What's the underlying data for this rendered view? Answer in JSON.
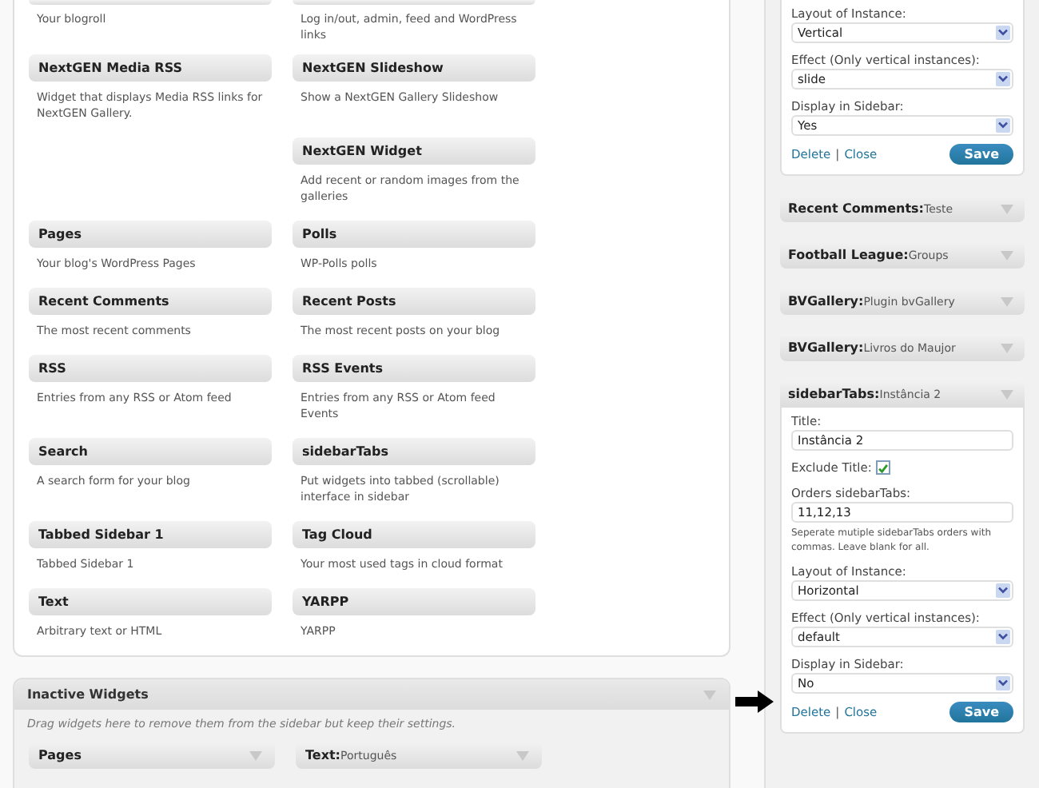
{
  "available_widgets": {
    "rows": [
      {
        "left": {
          "description": "Your blogroll"
        },
        "right": {
          "description": "Log in/out, admin, feed and WordPress links"
        }
      },
      {
        "left": {
          "title": "NextGEN Media RSS",
          "description": "Widget that displays Media RSS links for NextGEN Gallery."
        },
        "right": {
          "title": "NextGEN Slideshow",
          "description": "Show a NextGEN Gallery Slideshow"
        }
      },
      {
        "right": {
          "title": "NextGEN Widget",
          "description": "Add recent or random images from the galleries"
        }
      },
      {
        "left": {
          "title": "Pages",
          "description": "Your blog's WordPress Pages"
        },
        "right": {
          "title": "Polls",
          "description": "WP-Polls polls"
        }
      },
      {
        "left": {
          "title": "Recent Comments",
          "description": "The most recent comments"
        },
        "right": {
          "title": "Recent Posts",
          "description": "The most recent posts on your blog"
        }
      },
      {
        "left": {
          "title": "RSS",
          "description": "Entries from any RSS or Atom feed"
        },
        "right": {
          "title": "RSS Events",
          "description": "Entries from any RSS or Atom feed Events"
        }
      },
      {
        "left": {
          "title": "Search",
          "description": "A search form for your blog"
        },
        "right": {
          "title": "sidebarTabs",
          "description": "Put widgets into tabbed (scrollable) interface in sidebar"
        }
      },
      {
        "left": {
          "title": "Tabbed Sidebar 1",
          "description": "Tabbed Sidebar 1"
        },
        "right": {
          "title": "Tag Cloud",
          "description": "Your most used tags in cloud format"
        }
      },
      {
        "left": {
          "title": "Text",
          "description": "Arbitrary text or HTML"
        },
        "right": {
          "title": "YARPP",
          "description": "YARPP"
        }
      }
    ]
  },
  "inactive_widgets": {
    "title": "Inactive Widgets",
    "hint": "Drag widgets here to remove them from the sidebar but keep their settings.",
    "widgets": [
      {
        "name": "Pages"
      },
      {
        "name": "Text:",
        "title": "Português"
      }
    ]
  },
  "sidebar": {
    "widgets": [
      {
        "kind": "open",
        "fields": [
          {
            "kind": "select",
            "label": "Layout of Instance:",
            "value": "Vertical"
          },
          {
            "kind": "select",
            "label": "Effect (Only vertical instances):",
            "value": "slide"
          },
          {
            "kind": "select",
            "label": "Display in Sidebar:",
            "value": "Yes"
          }
        ],
        "links": [
          "Delete",
          "|",
          "Close"
        ],
        "save": "Save"
      },
      {
        "kind": "closed",
        "name": "Recent Comments:",
        "title": "Teste"
      },
      {
        "kind": "closed",
        "name": "Football League:",
        "title": "Groups"
      },
      {
        "kind": "closed",
        "name": "BVGallery:",
        "title": "Plugin bvGallery"
      },
      {
        "kind": "closed",
        "name": "BVGallery:",
        "title": "Livros do Maujor"
      },
      {
        "kind": "open",
        "name": "sidebarTabs:",
        "title": "Instância 2",
        "fields": [
          {
            "kind": "text",
            "label": "Title:",
            "value": "Instância 2"
          },
          {
            "kind": "checkbox",
            "label": "Exclude Title:",
            "checked": true
          },
          {
            "kind": "text",
            "label": "Orders sidebarTabs:",
            "value": "11,12,13",
            "hint": "Seperate mutiple sidebarTabs orders with commas. Leave blank for all."
          },
          {
            "kind": "select",
            "label": "Layout of Instance:",
            "value": "Horizontal"
          },
          {
            "kind": "select",
            "label": "Effect (Only vertical instances):",
            "value": "default"
          },
          {
            "kind": "select",
            "label": "Display in Sidebar:",
            "value": "No"
          }
        ],
        "links": [
          "Delete",
          "|",
          "Close"
        ],
        "save": "Save"
      }
    ]
  }
}
